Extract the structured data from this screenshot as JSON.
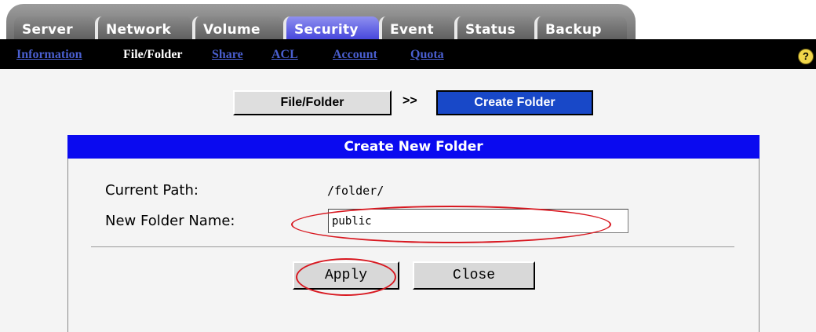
{
  "tabs": [
    {
      "label": "Server",
      "active": false
    },
    {
      "label": "Network",
      "active": false
    },
    {
      "label": "Volume",
      "active": false
    },
    {
      "label": "Security",
      "active": true
    },
    {
      "label": "Event",
      "active": false
    },
    {
      "label": "Status",
      "active": false
    },
    {
      "label": "Backup",
      "active": false
    }
  ],
  "subnav": [
    {
      "label": "Information",
      "current": false
    },
    {
      "label": "File/Folder",
      "current": true
    },
    {
      "label": "Share",
      "current": false
    },
    {
      "label": "ACL",
      "current": false
    },
    {
      "label": "Account",
      "current": false
    },
    {
      "label": "Quota",
      "current": false
    }
  ],
  "help_icon": {
    "glyph": "?",
    "icon": "help-icon"
  },
  "breadcrumb": {
    "parent": "File/Folder",
    "separator": ">>",
    "current": "Create Folder"
  },
  "panel": {
    "title": "Create New Folder",
    "current_path_label": "Current Path:",
    "current_path_value": "/folder/",
    "folder_name_label": "New Folder Name:",
    "folder_name_value": "public"
  },
  "actions": {
    "apply_label": "Apply",
    "close_label": "Close"
  },
  "colors": {
    "active_tab": "#3b3bd9",
    "panel_header": "#0a0af0",
    "breadcrumb_current": "#1848c8",
    "subnav_link": "#4a5fd0",
    "annotation": "#d81820"
  }
}
